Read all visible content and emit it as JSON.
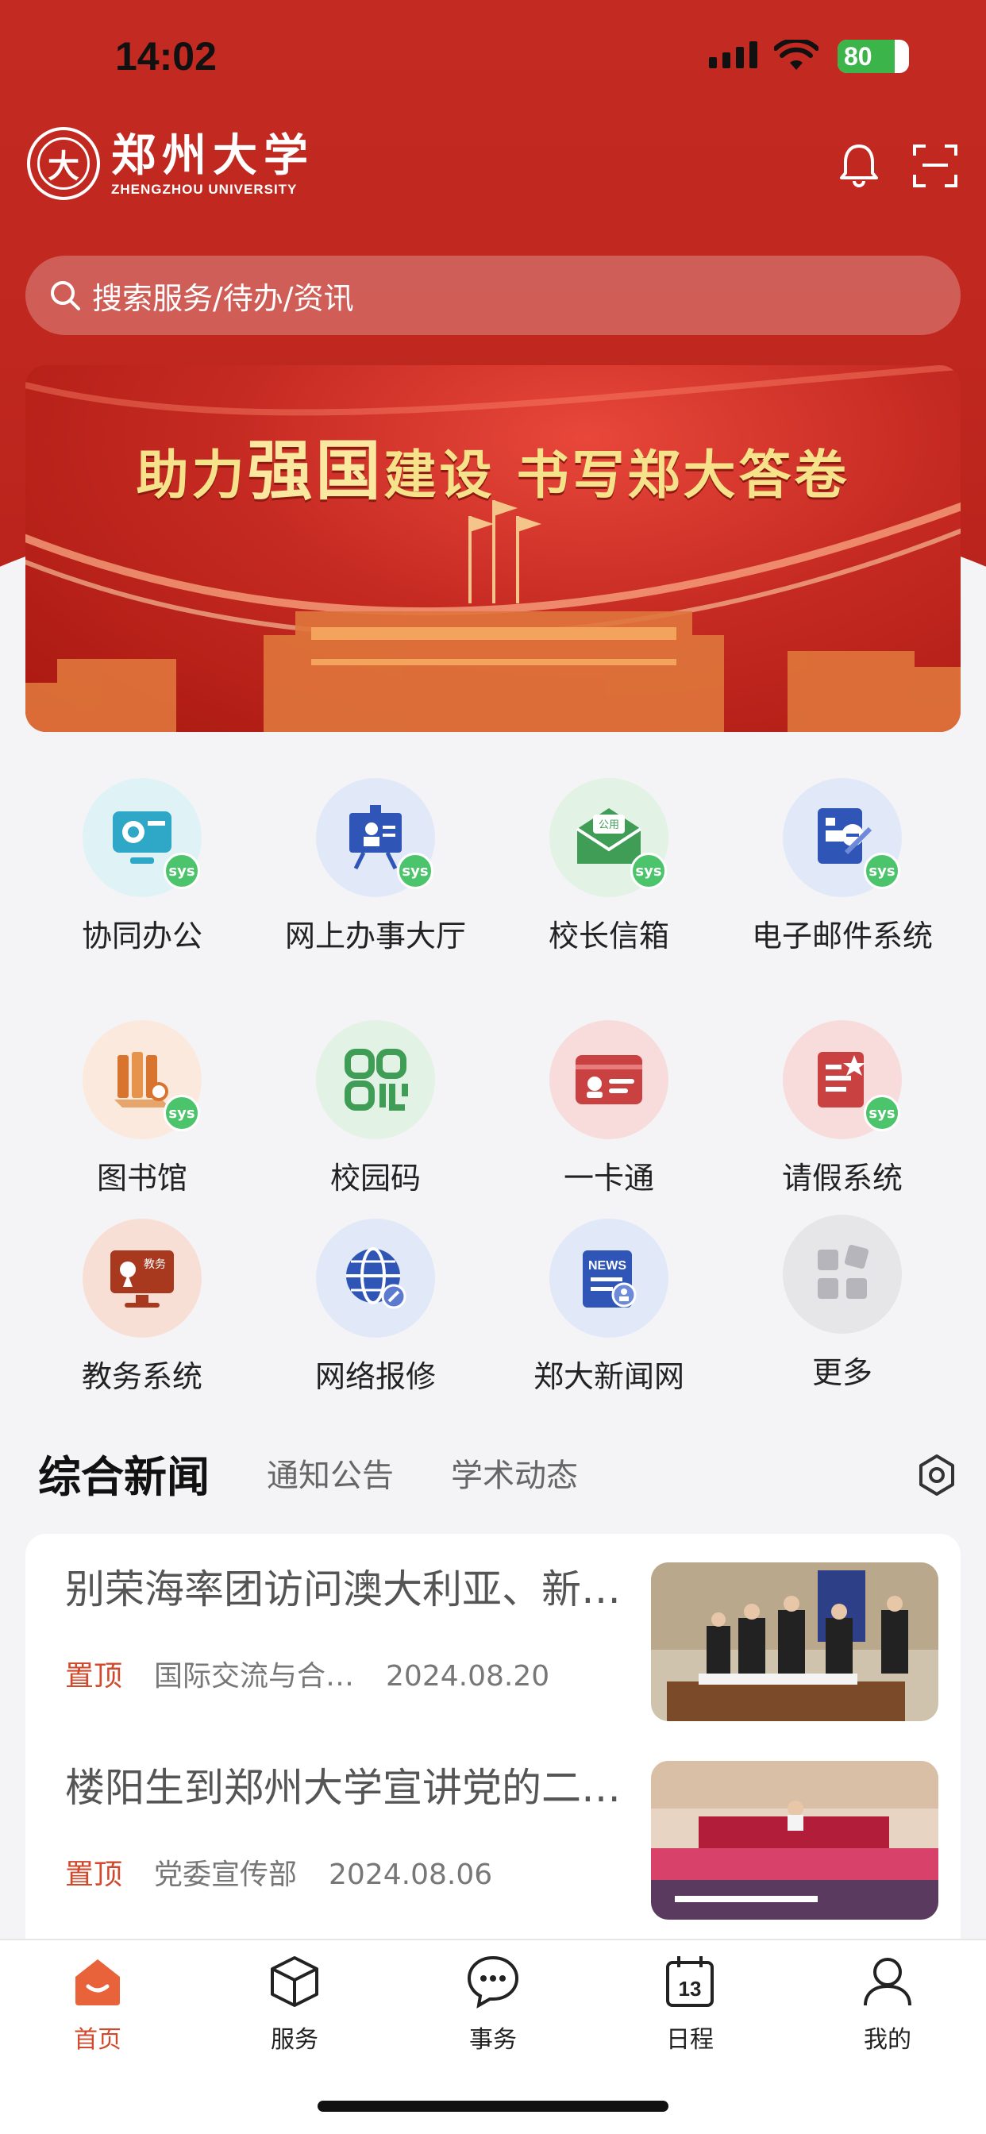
{
  "status_bar": {
    "time": "14:02",
    "battery": "80",
    "battery_level": 0.8
  },
  "header": {
    "university_cn": "郑州大学",
    "university_en": "ZHENGZHOU UNIVERSITY",
    "icons": [
      "bell-icon",
      "scan-icon"
    ]
  },
  "search": {
    "placeholder": "搜索服务/待办/资讯"
  },
  "banner": {
    "slogan_a": "助力",
    "slogan_b": "强国",
    "slogan_c": "建设  书写郑大答卷"
  },
  "apps": [
    {
      "label": "协同办公",
      "icon": "collaboration-office-icon",
      "sys": true
    },
    {
      "label": "网上办事大厅",
      "icon": "online-service-hall-icon",
      "sys": true
    },
    {
      "label": "校长信箱",
      "icon": "president-mailbox-icon",
      "sys": true,
      "badge_text": "公用"
    },
    {
      "label": "电子邮件系统",
      "icon": "email-system-icon",
      "sys": true
    },
    {
      "label": "图书馆",
      "icon": "library-icon",
      "sys": true
    },
    {
      "label": "校园码",
      "icon": "campus-code-icon",
      "sys": false
    },
    {
      "label": "一卡通",
      "icon": "campus-card-icon",
      "sys": false
    },
    {
      "label": "请假系统",
      "icon": "leave-system-icon",
      "sys": true
    },
    {
      "label": "教务系统",
      "icon": "academic-affairs-icon",
      "sys": false,
      "badge_text": "教务"
    },
    {
      "label": "网络报修",
      "icon": "network-repair-icon",
      "sys": false
    },
    {
      "label": "郑大新闻网",
      "icon": "news-site-icon",
      "sys": false,
      "badge_text": "NEWS"
    },
    {
      "label": "更多",
      "icon": "more-grid-icon",
      "sys": false
    }
  ],
  "sys_badge": "sys",
  "news_tabs": {
    "active": "综合新闻",
    "tab2": "通知公告",
    "tab3": "学术动态"
  },
  "news": [
    {
      "title": "别荣海率团访问澳大利亚、新西兰高校",
      "pin": "置顶",
      "source": "国际交流与合…",
      "date": "2024.08.20"
    },
    {
      "title": "楼阳生到郑州大学宣讲党的二十届三中全会精神",
      "pin": "置顶",
      "source": "党委宣传部",
      "date": "2024.08.06"
    }
  ],
  "tabbar": [
    {
      "label": "首页",
      "icon": "home-icon",
      "active": true
    },
    {
      "label": "服务",
      "icon": "service-box-icon",
      "active": false
    },
    {
      "label": "事务",
      "icon": "chat-bubble-icon",
      "active": false
    },
    {
      "label": "日程",
      "icon": "calendar-icon",
      "active": false,
      "day": "13"
    },
    {
      "label": "我的",
      "icon": "profile-icon",
      "active": false
    }
  ],
  "colors": {
    "brand_red": "#c22a22",
    "accent_orange": "#d2482b",
    "sys_green": "#4cc46b"
  }
}
